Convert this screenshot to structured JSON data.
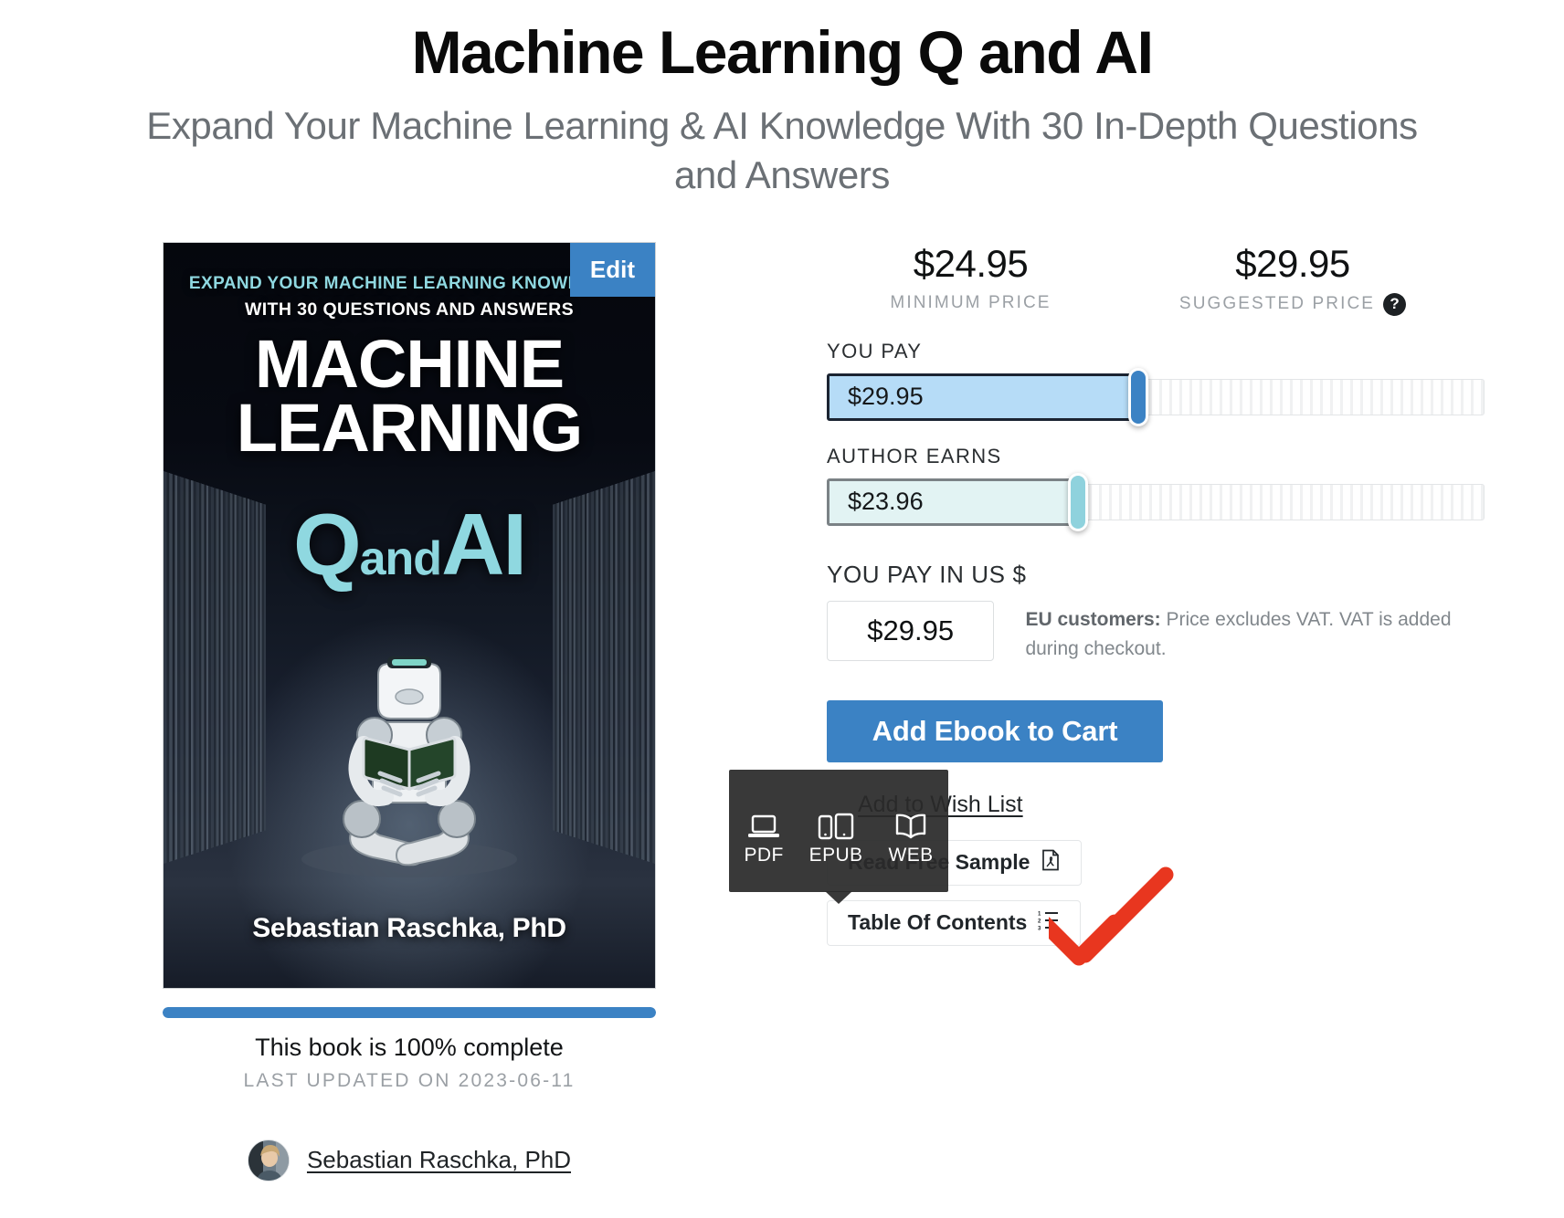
{
  "header": {
    "title": "Machine Learning Q and AI",
    "subtitle": "Expand Your Machine Learning & AI Knowledge With 30 In-Depth Questions and Answers"
  },
  "cover": {
    "edit_label": "Edit",
    "kicker_line1": "EXPAND YOUR MACHINE LEARNING KNOWLEDGE",
    "kicker_line2": "WITH 30 QUESTIONS AND ANSWERS",
    "main_line1": "MACHINE",
    "main_line2": "LEARNING",
    "accent_q": "Q",
    "accent_and": "and",
    "accent_ai": "AI",
    "author": "Sebastian Raschka, PhD",
    "accent_color": "#8FD8E0",
    "background_color": "#05070D"
  },
  "progress": {
    "percent": 100,
    "complete_text": "This book is 100% complete",
    "last_updated": "LAST UPDATED ON 2023-06-11",
    "bar_color": "#3B82C4"
  },
  "author_byline": {
    "name": "Sebastian Raschka, PhD",
    "avatar_alt": "author-avatar"
  },
  "pricing": {
    "minimum_price_amount": "$24.95",
    "minimum_price_label": "MINIMUM PRICE",
    "suggested_price_amount": "$29.95",
    "suggested_price_label": "SUGGESTED PRICE",
    "help_glyph": "?",
    "you_pay_label": "YOU PAY",
    "you_pay_value": "$29.95",
    "you_pay_fill_color": "#B6DCF7",
    "you_pay_thumb_color": "#3B82C4",
    "author_earns_label": "AUTHOR EARNS",
    "author_earns_value": "$23.96",
    "author_earns_fill_color": "#E2F3F3",
    "author_earns_thumb_color": "#8FD2DD",
    "us_dollar_label": "YOU PAY IN US $",
    "us_dollar_value": "$29.95",
    "vat_note_bold": "EU customers:",
    "vat_note_rest": " Price excludes VAT. VAT is added during checkout."
  },
  "actions": {
    "add_to_cart": "Add Ebook to Cart",
    "add_to_cart_color": "#3B82C4",
    "add_to_wish_list": "Add to Wish List",
    "read_free_sample": "Read Free Sample",
    "read_free_sample_icon": "pdf-file-icon",
    "table_of_contents": "Table Of Contents",
    "table_of_contents_icon": "ordered-list-icon"
  },
  "format_tooltip": {
    "background_color": "#2A2A2A",
    "formats": [
      {
        "label": "PDF",
        "icon": "laptop-icon"
      },
      {
        "label": "EPUB",
        "icon": "phone-tablet-icon"
      },
      {
        "label": "WEB",
        "icon": "open-book-icon"
      }
    ]
  },
  "annotation": {
    "arrow_color": "#E8361F",
    "arrow_direction": "down-left"
  }
}
